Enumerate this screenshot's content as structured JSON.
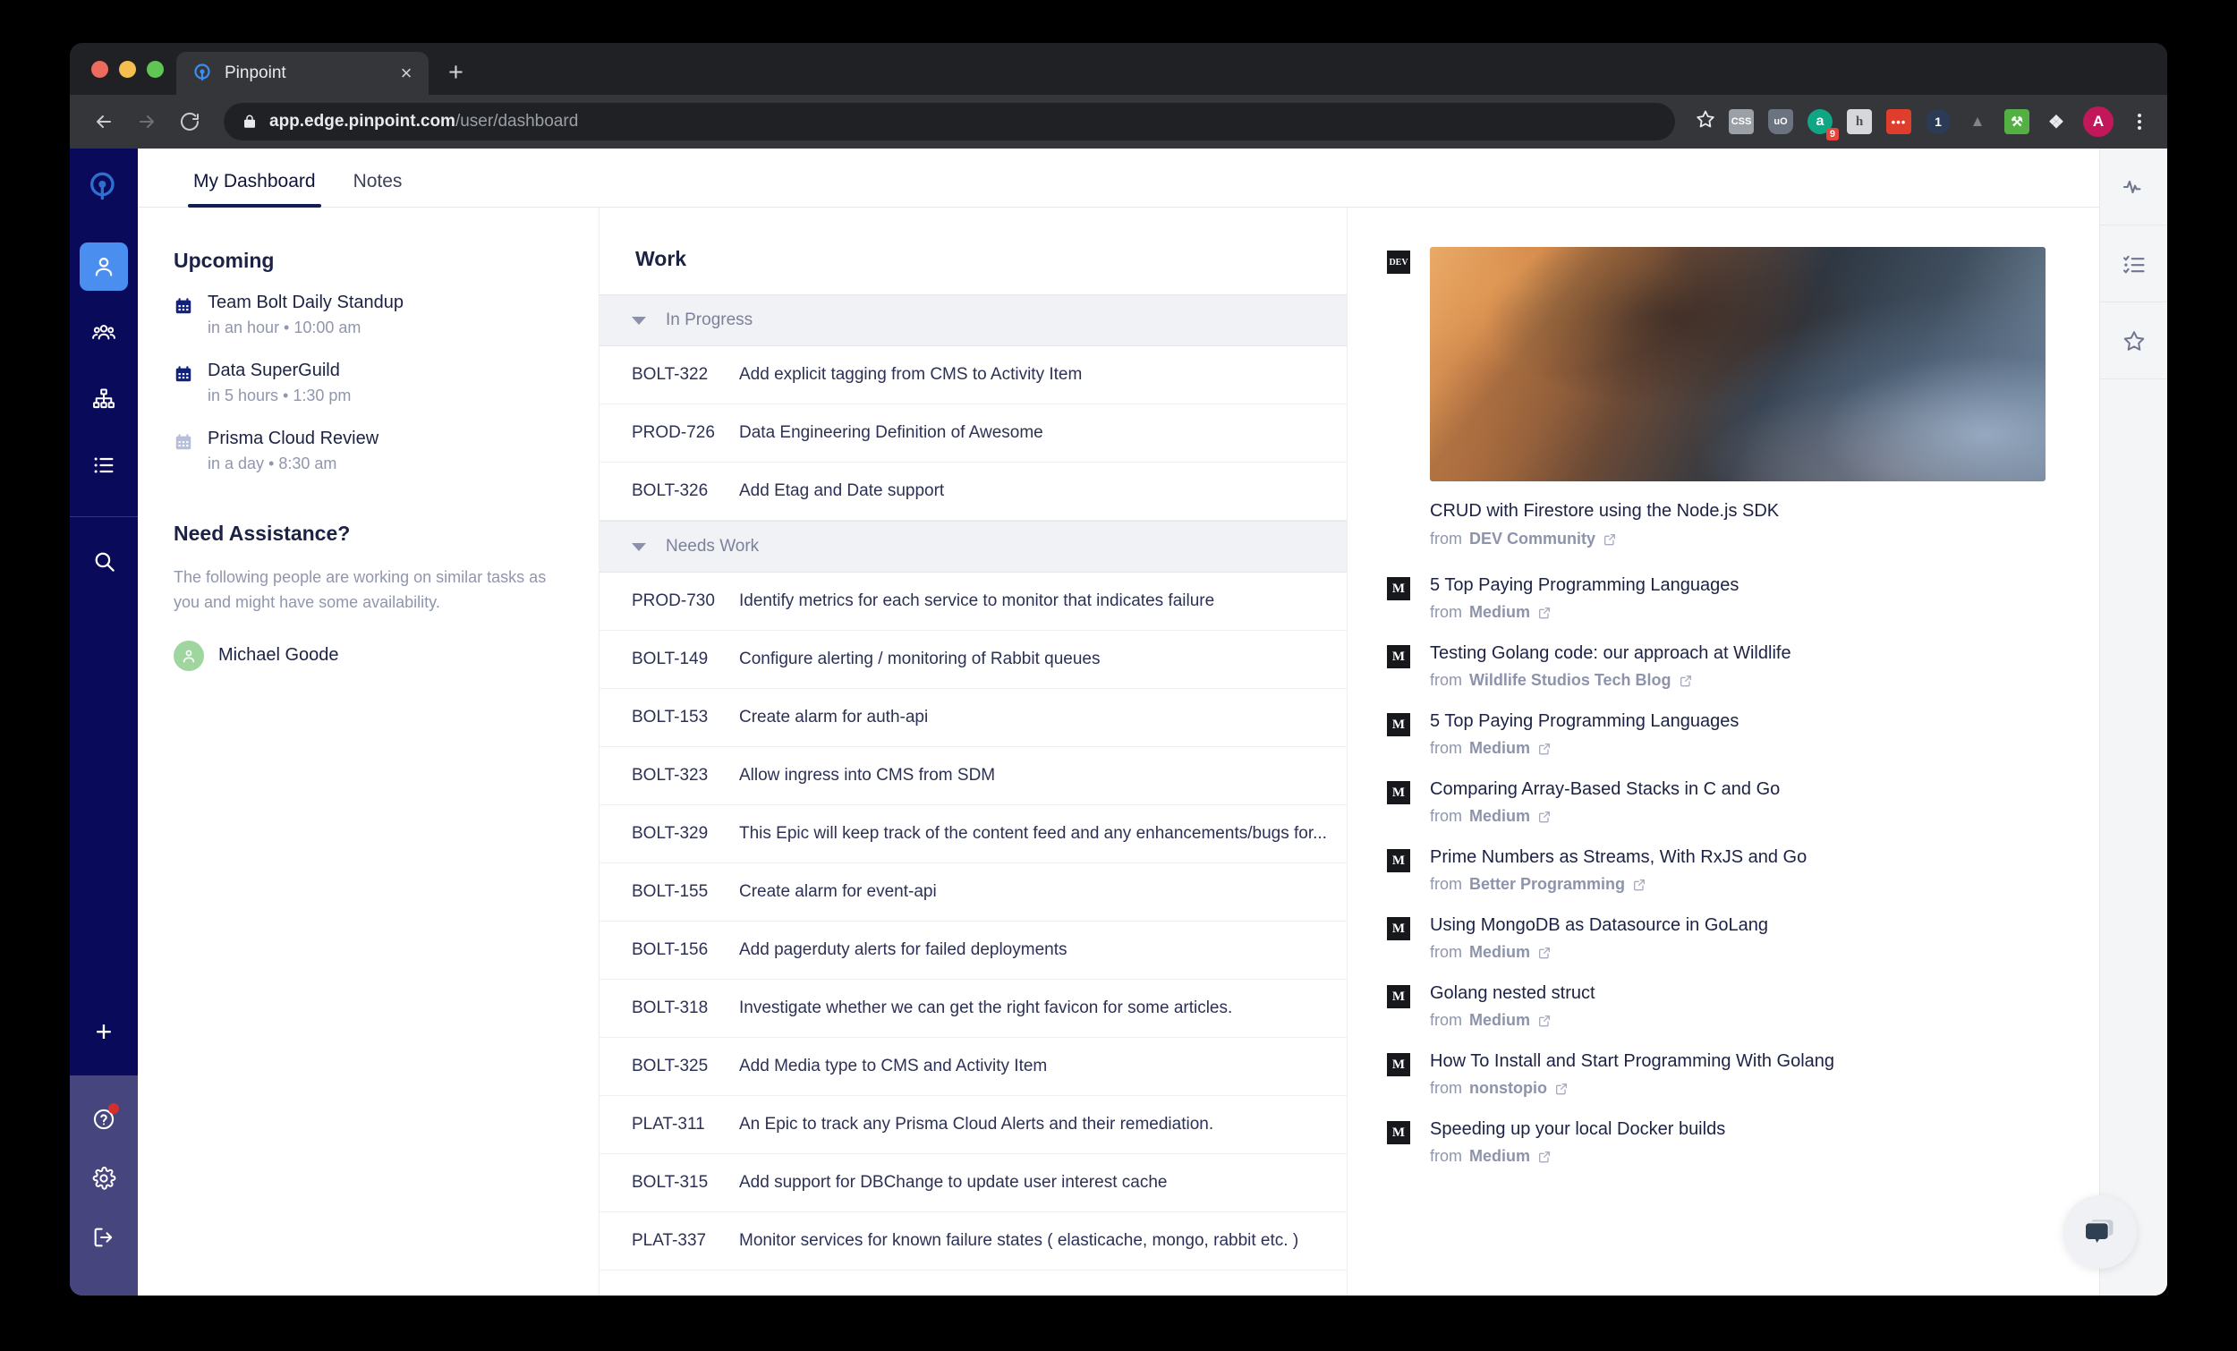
{
  "browser": {
    "tab_title": "Pinpoint",
    "tab_favicon": "pinpoint-logo-icon",
    "close_label": "×",
    "new_tab_label": "+",
    "url_host": "app.edge.pinpoint.com",
    "url_path": "/user/dashboard",
    "back_label": "←",
    "forward_label": "→",
    "reload_label": "⟳",
    "lock_icon": "lock-icon",
    "star_icon": "bookmark-star-icon",
    "profile_initial": "A",
    "extensions": [
      {
        "name": "css-viewer-extension",
        "label": "CSS",
        "bg": "#9aa0a6",
        "fg": "#ffffff"
      },
      {
        "name": "ublock-origin-extension",
        "label": "uO",
        "bg": "#6b7280",
        "fg": "#ffffff"
      },
      {
        "name": "grammarly-extension",
        "label": "a",
        "bg": "#11a683",
        "fg": "#ffffff",
        "badge": "9"
      },
      {
        "name": "honey-extension",
        "label": "h",
        "bg": "#d5d7da",
        "fg": "#4c5058"
      },
      {
        "name": "dots-extension",
        "label": "•••",
        "bg": "#e03e2d",
        "fg": "#ffffff"
      },
      {
        "name": "one-password-extension",
        "label": "1",
        "bg": "#2b3a55",
        "fg": "#ffffff"
      },
      {
        "name": "mountains-extension",
        "label": "▲",
        "bg": "#35363a",
        "fg": "#9aa0a6"
      },
      {
        "name": "toolbox-extension",
        "label": "⚒",
        "bg": "#53b043",
        "fg": "#ffffff"
      },
      {
        "name": "puzzle-extensions-menu",
        "label": "❖",
        "bg": "#35363a",
        "fg": "#e8eaed"
      }
    ]
  },
  "sidebar": {
    "logo": "pinpoint-logo-icon",
    "items": [
      {
        "name": "sidebar-item-profile",
        "icon": "person-icon",
        "active": true
      },
      {
        "name": "sidebar-item-teams",
        "icon": "people-group-icon",
        "active": false
      },
      {
        "name": "sidebar-item-org-chart",
        "icon": "org-chart-icon",
        "active": false
      },
      {
        "name": "sidebar-item-backlog",
        "icon": "list-icon",
        "active": false
      },
      {
        "name": "sidebar-item-search",
        "icon": "search-icon",
        "active": false
      }
    ],
    "add_label": "+",
    "bottom_items": [
      {
        "name": "sidebar-item-help",
        "icon": "question-circle-icon",
        "has_notification": true
      },
      {
        "name": "sidebar-item-settings",
        "icon": "gear-icon",
        "has_notification": false
      },
      {
        "name": "sidebar-item-logout",
        "icon": "logout-icon",
        "has_notification": false
      }
    ]
  },
  "tabs": [
    {
      "label": "My Dashboard",
      "active": true
    },
    {
      "label": "Notes",
      "active": false
    }
  ],
  "upcoming": {
    "title": "Upcoming",
    "events": [
      {
        "name": "Team Bolt Daily Standup",
        "meta": "in an hour • 10:00 am",
        "muted": false
      },
      {
        "name": "Data SuperGuild",
        "meta": "in 5 hours • 1:30 pm",
        "muted": false
      },
      {
        "name": "Prisma Cloud Review",
        "meta": "in a day • 8:30 am",
        "muted": true
      }
    ]
  },
  "assistance": {
    "title": "Need Assistance?",
    "description": "The following people are working on similar tasks as you and might have some availability.",
    "people": [
      {
        "name": "Michael Goode",
        "avatar_color": "#9fd6a0"
      }
    ]
  },
  "work": {
    "title": "Work",
    "groups": [
      {
        "label": "In Progress",
        "expanded": true,
        "rows": [
          {
            "key": "BOLT-322",
            "title": "Add explicit tagging from CMS to Activity Item"
          },
          {
            "key": "PROD-726",
            "title": "Data Engineering Definition of Awesome"
          },
          {
            "key": "BOLT-326",
            "title": "Add Etag and Date support"
          }
        ]
      },
      {
        "label": "Needs Work",
        "expanded": true,
        "rows": [
          {
            "key": "PROD-730",
            "title": "Identify metrics for each service to monitor that indicates failure"
          },
          {
            "key": "BOLT-149",
            "title": "Configure alerting / monitoring of Rabbit queues"
          },
          {
            "key": "BOLT-153",
            "title": "Create alarm for auth-api"
          },
          {
            "key": "BOLT-323",
            "title": "Allow ingress into CMS from SDM"
          },
          {
            "key": "BOLT-329",
            "title": "This Epic will keep track of the content feed and any enhancements/bugs for..."
          },
          {
            "key": "BOLT-155",
            "title": "Create alarm for event-api"
          },
          {
            "key": "BOLT-156",
            "title": "Add pagerduty alerts for failed deployments"
          },
          {
            "key": "BOLT-318",
            "title": "Investigate whether we can get the right favicon for some articles."
          },
          {
            "key": "BOLT-325",
            "title": "Add Media type to CMS and Activity Item"
          },
          {
            "key": "PLAT-311",
            "title": "An Epic to track any Prisma Cloud Alerts and their remediation."
          },
          {
            "key": "BOLT-315",
            "title": "Add support for DBChange to update user interest cache"
          },
          {
            "key": "PLAT-337",
            "title": "Monitor services for known failure states ( elasticache, mongo, rabbit etc. )"
          }
        ]
      }
    ]
  },
  "feed": {
    "from_label": "from",
    "hero": {
      "favicon_label": "DEV",
      "title": "CRUD with Firestore using the Node.js SDK",
      "source": "DEV Community",
      "external_icon": "external-link-icon"
    },
    "items": [
      {
        "favicon_label": "M",
        "title": "5 Top Paying Programming Languages",
        "source": "Medium"
      },
      {
        "favicon_label": "M",
        "title": "Testing Golang code: our approach at Wildlife",
        "source": "Wildlife Studios Tech Blog"
      },
      {
        "favicon_label": "M",
        "title": "5 Top Paying Programming Languages",
        "source": "Medium"
      },
      {
        "favicon_label": "M",
        "title": "Comparing Array-Based Stacks in C and Go",
        "source": "Medium"
      },
      {
        "favicon_label": "M",
        "title": "Prime Numbers as Streams, With RxJS and Go",
        "source": "Better Programming"
      },
      {
        "favicon_label": "M",
        "title": "Using MongoDB as Datasource in GoLang",
        "source": "Medium"
      },
      {
        "favicon_label": "M",
        "title": "Golang nested struct",
        "source": "Medium"
      },
      {
        "favicon_label": "M",
        "title": "How To Install and Start Programming With Golang",
        "source": "nonstopio"
      },
      {
        "favicon_label": "M",
        "title": "Speeding up your local Docker builds",
        "source": "Medium"
      }
    ]
  },
  "rail": {
    "items": [
      {
        "name": "rail-item-activity",
        "icon": "pulse-icon"
      },
      {
        "name": "rail-item-checklist",
        "icon": "checklist-icon"
      },
      {
        "name": "rail-item-favorites",
        "icon": "star-icon"
      }
    ]
  },
  "chat": {
    "icon": "chat-bubble-icon"
  },
  "colors": {
    "sidebar_bg": "#0a0a5a",
    "sidebar_bottom_bg": "#46457e",
    "accent_blue": "#4a8ef0",
    "tab_underline": "#151b57",
    "group_header_bg": "#f1f2f6",
    "text_primary": "#1c2244",
    "text_muted": "#9096ad",
    "avatar_green": "#9fd6a0",
    "notification_red": "#d32f2f"
  }
}
